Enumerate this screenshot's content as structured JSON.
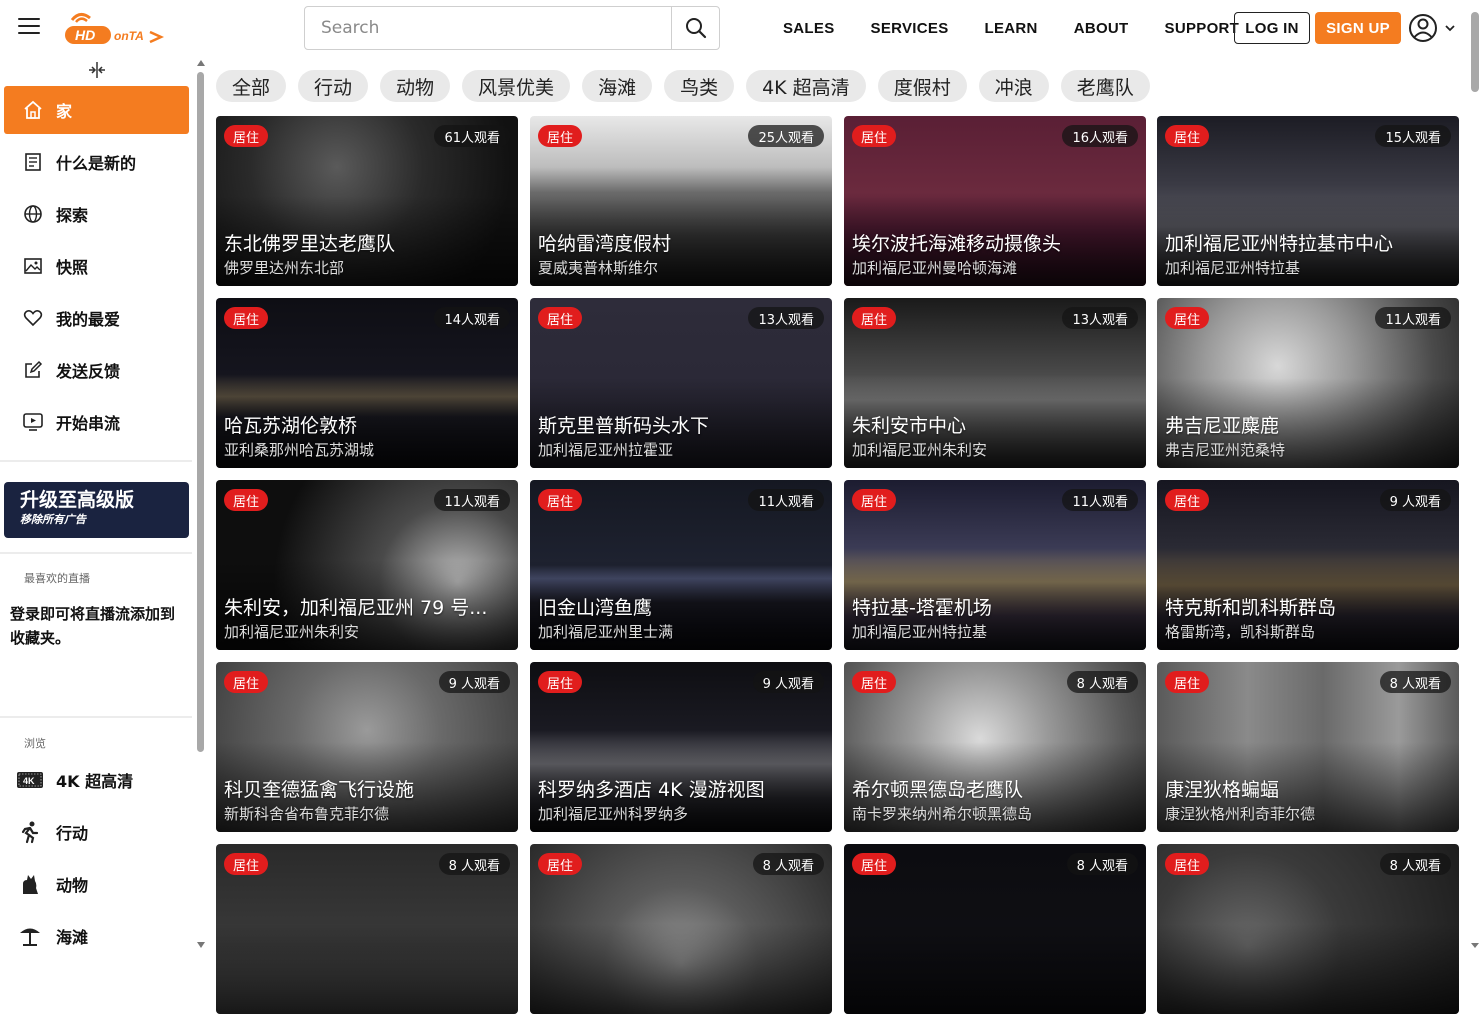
{
  "header": {
    "logo_text": "HDOnTap",
    "search_placeholder": "Search",
    "nav": [
      "SALES",
      "SERVICES",
      "LEARN",
      "ABOUT",
      "SUPPORT"
    ],
    "login_label": "LOG IN",
    "signup_label": "SIGN UP"
  },
  "sidebar": {
    "items": [
      {
        "label": "家",
        "icon": "home-icon"
      },
      {
        "label": "什么是新的",
        "icon": "newspaper-icon"
      },
      {
        "label": "探索",
        "icon": "globe-icon"
      },
      {
        "label": "快照",
        "icon": "image-icon"
      },
      {
        "label": "我的最爱",
        "icon": "heart-icon"
      },
      {
        "label": "发送反馈",
        "icon": "edit-icon"
      },
      {
        "label": "开始串流",
        "icon": "stream-icon"
      }
    ],
    "upgrade": {
      "title": "升级至高级版",
      "subtitle": "移除所有广告"
    },
    "favorites_label": "最喜欢的直播",
    "favorites_message": "登录即可将直播流添加到收藏夹。",
    "browse_label": "浏览",
    "browse_items": [
      {
        "label": "4K 超高清",
        "icon": "4k-icon"
      },
      {
        "label": "行动",
        "icon": "running-icon"
      },
      {
        "label": "动物",
        "icon": "cat-icon"
      },
      {
        "label": "海滩",
        "icon": "beach-umbrella-icon"
      }
    ]
  },
  "chips": [
    "全部",
    "行动",
    "动物",
    "风景优美",
    "海滩",
    "鸟类",
    "4K 超高清",
    "度假村",
    "冲浪",
    "老鹰队"
  ],
  "colors": {
    "accent": "#f47c20",
    "live": "#e11d1d",
    "upgrade_bg": "#1a2340"
  },
  "live_label": "居住",
  "cards": [
    {
      "viewers": "61人观看",
      "title": "东北佛罗里达老鹰队",
      "location": "佛罗里达州东北部"
    },
    {
      "viewers": "25人观看",
      "title": "哈纳雷湾度假村",
      "location": "夏威夷普林斯维尔"
    },
    {
      "viewers": "16人观看",
      "title": "埃尔波托海滩移动摄像头",
      "location": "加利福尼亚州曼哈顿海滩"
    },
    {
      "viewers": "15人观看",
      "title": "加利福尼亚州特拉基市中心",
      "location": "加利福尼亚州特拉基"
    },
    {
      "viewers": "14人观看",
      "title": "哈瓦苏湖伦敦桥",
      "location": "亚利桑那州哈瓦苏湖城"
    },
    {
      "viewers": "13人观看",
      "title": "斯克里普斯码头水下",
      "location": "加利福尼亚州拉霍亚"
    },
    {
      "viewers": "13人观看",
      "title": "朱利安市中心",
      "location": "加利福尼亚州朱利安"
    },
    {
      "viewers": "11人观看",
      "title": "弗吉尼亚麋鹿",
      "location": "弗吉尼亚州范桑特"
    },
    {
      "viewers": "11人观看",
      "title": "朱利安，加利福尼亚州 79 号...",
      "location": "加利福尼亚州朱利安"
    },
    {
      "viewers": "11人观看",
      "title": "旧金山湾鱼鹰",
      "location": "加利福尼亚州里士满"
    },
    {
      "viewers": "11人观看",
      "title": "特拉基-塔霍机场",
      "location": "加利福尼亚州特拉基"
    },
    {
      "viewers": "9 人观看",
      "title": "特克斯和凯科斯群岛",
      "location": "格雷斯湾，凯科斯群岛"
    },
    {
      "viewers": "9 人观看",
      "title": "科贝奎德猛禽飞行设施",
      "location": "新斯科舍省布鲁克菲尔德"
    },
    {
      "viewers": "9 人观看",
      "title": "科罗纳多酒店 4K 漫游视图",
      "location": "加利福尼亚州科罗纳多"
    },
    {
      "viewers": "8 人观看",
      "title": "希尔顿黑德岛老鹰队",
      "location": "南卡罗来纳州希尔顿黑德岛"
    },
    {
      "viewers": "8 人观看",
      "title": "康涅狄格蝙蝠",
      "location": "康涅狄格州利奇菲尔德"
    },
    {
      "viewers": "8 人观看",
      "title": "",
      "location": ""
    },
    {
      "viewers": "8 人观看",
      "title": "",
      "location": ""
    },
    {
      "viewers": "8 人观看",
      "title": "",
      "location": ""
    },
    {
      "viewers": "8 人观看",
      "title": "",
      "location": ""
    }
  ]
}
